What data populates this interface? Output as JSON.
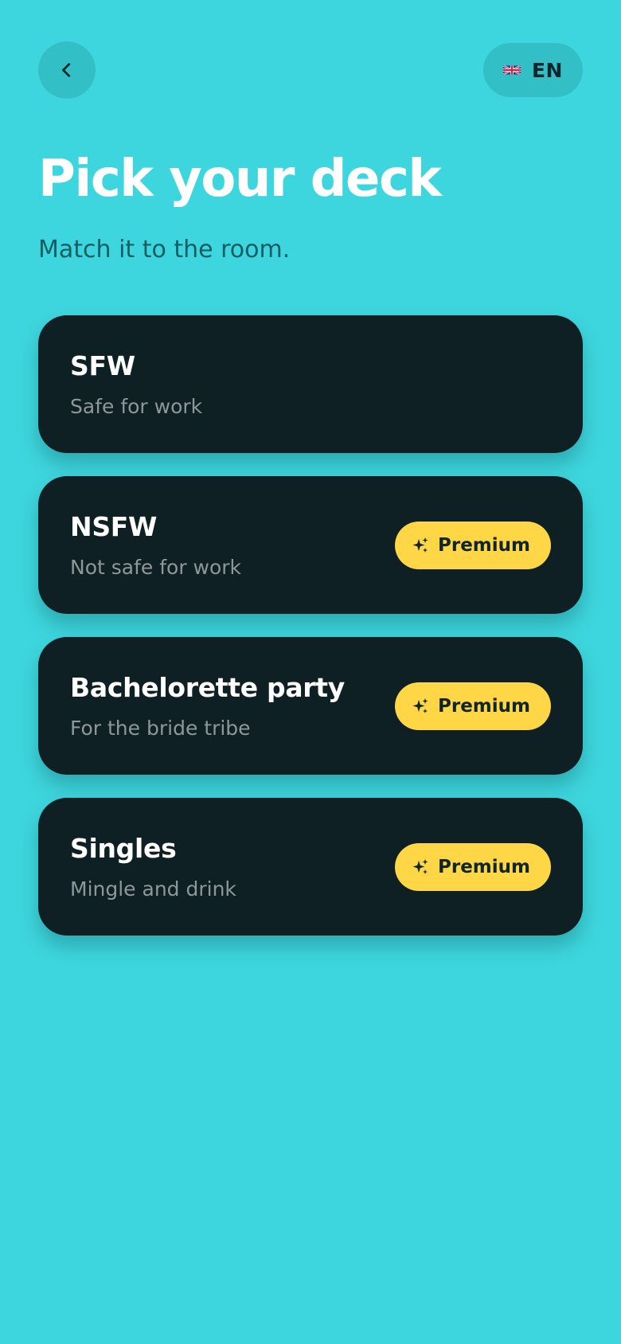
{
  "header": {
    "back_icon": "chevron-left-icon",
    "language": {
      "flag_icon": "uk-flag-icon",
      "code": "EN"
    }
  },
  "page": {
    "title": "Pick your deck",
    "subtitle": "Match it to the room."
  },
  "decks": [
    {
      "title": "SFW",
      "subtitle": "Safe for work",
      "badge": ""
    },
    {
      "title": "NSFW",
      "subtitle": "Not safe for work",
      "badge": "Premium"
    },
    {
      "title": "Bachelorette party",
      "subtitle": "For the bride tribe",
      "badge": "Premium"
    },
    {
      "title": "Singles",
      "subtitle": "Mingle and drink",
      "badge": "Premium"
    }
  ],
  "badge_icon": "sparkles-icon",
  "colors": {
    "background": "#3ed6de",
    "card": "#0f2024",
    "premium": "#ffd646",
    "subtitle": "#155e63"
  }
}
